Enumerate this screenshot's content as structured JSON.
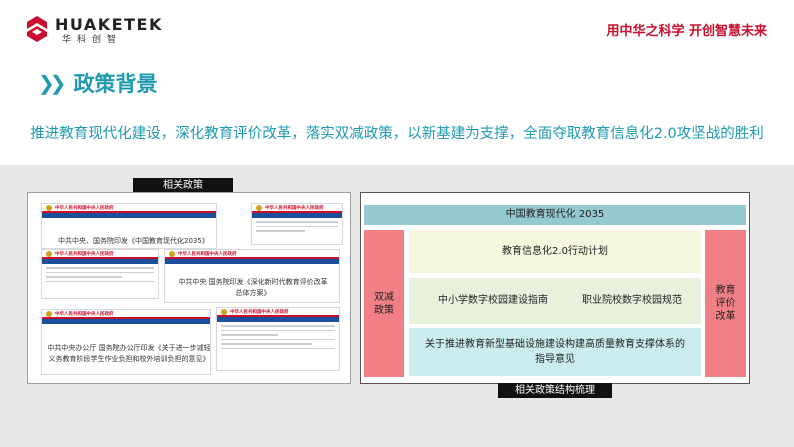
{
  "header": {
    "brand": "HUAKETEK",
    "brand_cn": "华科创智",
    "slogan": "用中华之科学 开创智慧未来"
  },
  "section": {
    "title": "政策背景",
    "subtitle": "推进教育现代化建设，深化教育评价改革，落实双减政策，以新基建为支撑，全面夺取教育信息化2.0攻坚战的胜利"
  },
  "left_panel": {
    "tag": "相关政策",
    "docs": [
      {
        "header": "中华人民共和国中央人民政府",
        "caption": "中共中央、国务院印发《中国教育现代化2035》"
      },
      {
        "header": "中华人民共和国中央人民政府",
        "caption": ""
      },
      {
        "header": "中华人民共和国中央人民政府",
        "caption": ""
      },
      {
        "header": "中华人民共和国中央人民政府",
        "caption": "中共中央 国务院印发《深化新时代教育评价改革总体方案》"
      },
      {
        "header": "中华人民共和国中央人民政府",
        "caption": "中共中央办公厅 国务院办公厅印发《关于进一步减轻义务教育阶段学生作业负担和校外培训负担的意见》"
      },
      {
        "header": "中华人民共和国中央人民政府",
        "caption": ""
      }
    ]
  },
  "right_panel": {
    "tag": "相关政策结构梳理",
    "top": "中国教育现代化 2035",
    "left": "双减政策",
    "right": "教育评价改革",
    "action": "教育信息化2.0行动计划",
    "mid_left": "中小学数字校园建设指南",
    "mid_right": "职业院校数字校园规范",
    "bottom": "关于推进教育新型基础设施建设构建高质量教育支撑体系的指导意见"
  },
  "colors": {
    "accent": "#1e9ab0",
    "brand_red": "#c8102e",
    "band_bg": "#e8e8e8",
    "teal_box": "#94c9cf",
    "pink_box": "#f08086",
    "cream_box": "#f6f7df",
    "green_box": "#e8f1dc",
    "cyan_box": "#cbedef"
  },
  "icons": {
    "logo": "huaketek-logo-icon",
    "chevrons": "double-chevron-right-icon"
  }
}
